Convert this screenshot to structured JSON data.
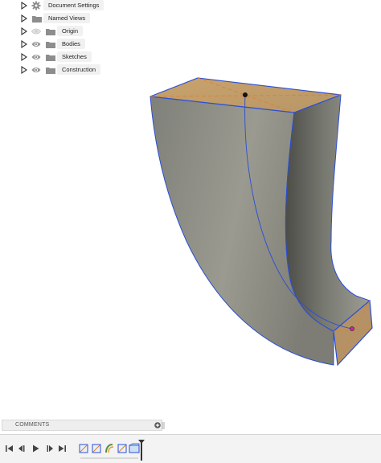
{
  "browser": {
    "items": [
      {
        "label": "Document Settings",
        "icon": "gear-icon",
        "visible": null
      },
      {
        "label": "Named Views",
        "icon": "folder-icon",
        "visible": null
      },
      {
        "label": "Origin",
        "icon": "folder-icon",
        "visible": false
      },
      {
        "label": "Bodies",
        "icon": "folder-icon",
        "visible": true
      },
      {
        "label": "Sketches",
        "icon": "folder-icon",
        "visible": true
      },
      {
        "label": "Construction",
        "icon": "folder-icon",
        "visible": true
      }
    ]
  },
  "comments": {
    "label": "COMMENTS"
  },
  "timeline": {
    "controls": [
      "skip-to-start-icon",
      "step-back-icon",
      "play-icon",
      "step-forward-icon",
      "skip-to-end-icon"
    ],
    "features": [
      "sketch-icon",
      "sketch-icon",
      "loft-icon",
      "sketch-icon",
      "extrude-icon"
    ]
  },
  "colors": {
    "body_face": "#8e8e84",
    "body_edge": "#2a4fd6",
    "sketch_plane": "#d8a25c",
    "panel_bg": "#f1f1f1",
    "timeline_bg": "#f3f3f3"
  }
}
